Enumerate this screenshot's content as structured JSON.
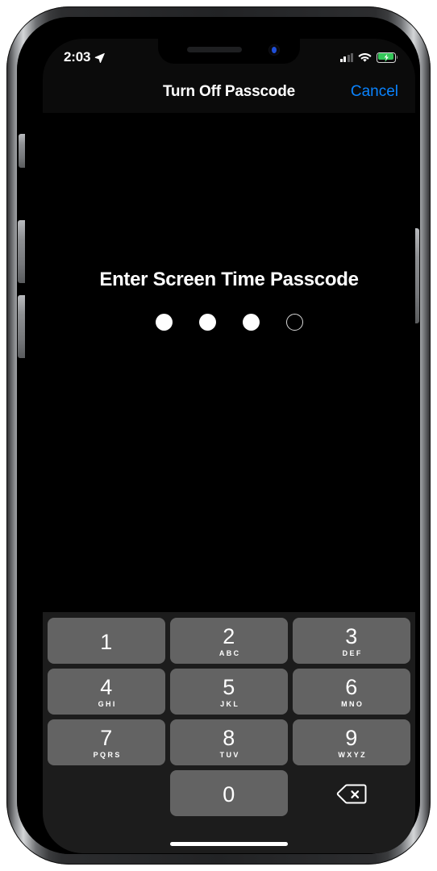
{
  "device": {
    "type": "iphone",
    "frame_color": "#222325",
    "screen_bg": "#000000"
  },
  "status_bar": {
    "time": "2:03",
    "location_icon": "location-arrow-icon",
    "signal_icon": "cellular-signal-icon",
    "signal_bars_total": 4,
    "signal_bars_filled": 2,
    "wifi_icon": "wifi-icon",
    "battery_icon": "battery-charging-icon",
    "battery_charging": true,
    "battery_color": "#34c759"
  },
  "nav_bar": {
    "title": "Turn Off Passcode",
    "cancel_label": "Cancel",
    "accent_color": "#0a84ff",
    "background": "#0b0b0b"
  },
  "passcode": {
    "prompt": "Enter Screen Time Passcode",
    "total_digits": 4,
    "entered_digits": 3,
    "dots": [
      "filled",
      "filled",
      "filled",
      "empty"
    ]
  },
  "keypad": {
    "background": "#1c1c1c",
    "key_color": "#636363",
    "rows": [
      [
        {
          "digit": "1",
          "letters": ""
        },
        {
          "digit": "2",
          "letters": "ABC"
        },
        {
          "digit": "3",
          "letters": "DEF"
        }
      ],
      [
        {
          "digit": "4",
          "letters": "GHI"
        },
        {
          "digit": "5",
          "letters": "JKL"
        },
        {
          "digit": "6",
          "letters": "MNO"
        }
      ],
      [
        {
          "digit": "7",
          "letters": "PQRS"
        },
        {
          "digit": "8",
          "letters": "TUV"
        },
        {
          "digit": "9",
          "letters": "WXYZ"
        }
      ]
    ],
    "zero": {
      "digit": "0",
      "letters": ""
    },
    "delete_icon": "backspace-delete-icon"
  },
  "home_indicator": {
    "icon": "home-indicator-bar"
  }
}
